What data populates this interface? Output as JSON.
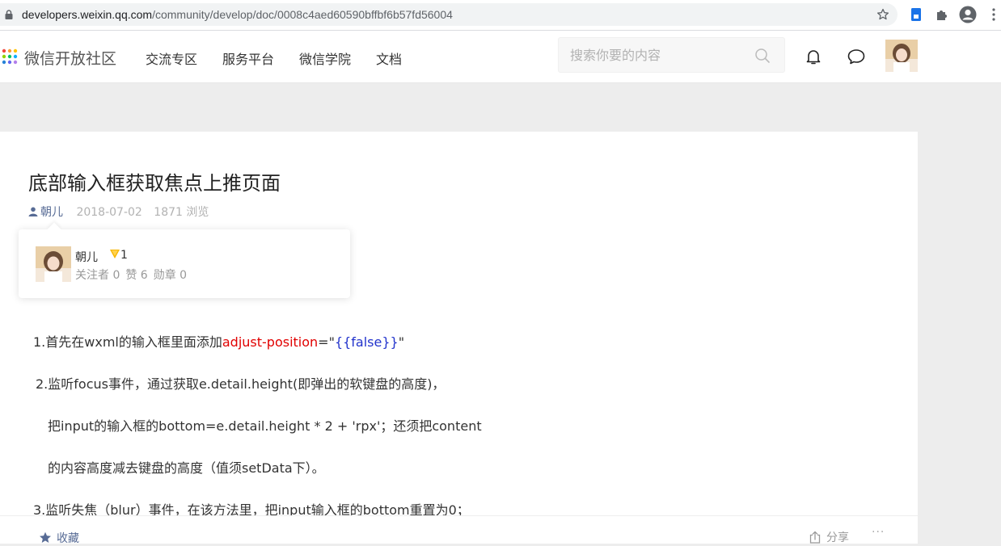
{
  "browser": {
    "url_host": "developers.weixin.qq.com",
    "url_path": "/community/develop/doc/0008c4aed60590bffbf6b57fd56004"
  },
  "header": {
    "brand": "微信开放社区",
    "nav": [
      "交流专区",
      "服务平台",
      "微信学院",
      "文档"
    ],
    "search_placeholder": "搜索你要的内容"
  },
  "article": {
    "title": "底部输入框获取焦点上推页面",
    "author": "朝儿",
    "date": "2018-07-02",
    "views": "1871 浏览"
  },
  "author_card": {
    "name": "朝儿",
    "level": "1",
    "followers": "关注者 0",
    "likes": "赞 6",
    "medals": "勋章 0"
  },
  "content": {
    "p1_prefix": "1.首先在wxml的输入框里面添加",
    "p1_attr": "adjust-position",
    "p1_eq": "=\"",
    "p1_value": "{{false}}",
    "p1_end": "\"",
    "p2": "2.监听focus事件，通过获取e.detail.height(即弹出的软键盘的高度)，",
    "p3": "把input的输入框的bottom=e.detail.height * 2 + 'rpx'；还须把content",
    "p4": "的内容高度减去键盘的高度（值须setData下）。",
    "p5": "3.监听失焦（blur）事件，在该方法里，把input输入框的bottom重置为0；"
  },
  "actions": {
    "favorite": "收藏",
    "share": "分享",
    "more": "···"
  },
  "colors": {
    "link": "#576b95",
    "attr_red": "#e10000",
    "value_blue": "#2233cc",
    "badge_gold": "#f7b500"
  }
}
